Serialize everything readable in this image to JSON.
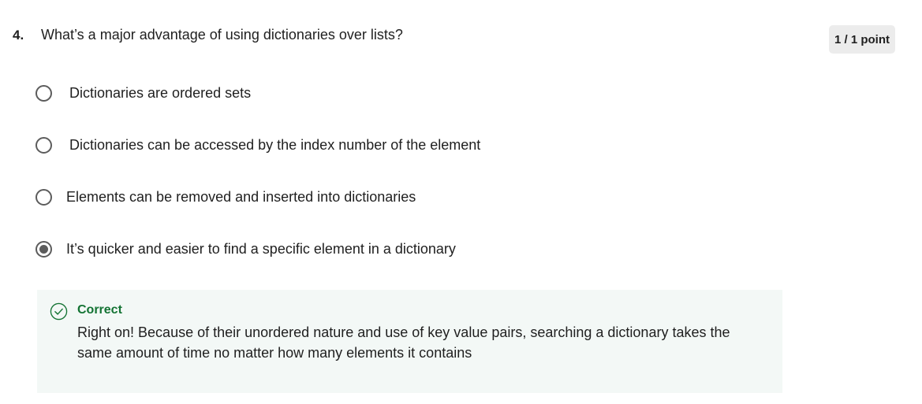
{
  "question": {
    "number": "4.",
    "text": "What’s a major advantage of using dictionaries over lists?",
    "score": "1 / 1 point"
  },
  "options": [
    {
      "label": "Dictionaries are ordered sets",
      "selected": false
    },
    {
      "label": "Dictionaries can be accessed by the index number of the element",
      "selected": false
    },
    {
      "label": "Elements can be removed and inserted into dictionaries",
      "selected": false
    },
    {
      "label": "It’s quicker and easier to find a specific element in a dictionary",
      "selected": true
    }
  ],
  "feedback": {
    "status": "Correct",
    "icon": "check-circle-icon",
    "message": "Right on! Because of their unordered nature and use of key value pairs, searching a dictionary takes the same amount of time no matter how many elements it contains"
  },
  "colors": {
    "success": "#137333",
    "feedback_bg": "#f3f8f6",
    "badge_bg": "#ececec",
    "radio": "#5c5c5c"
  }
}
